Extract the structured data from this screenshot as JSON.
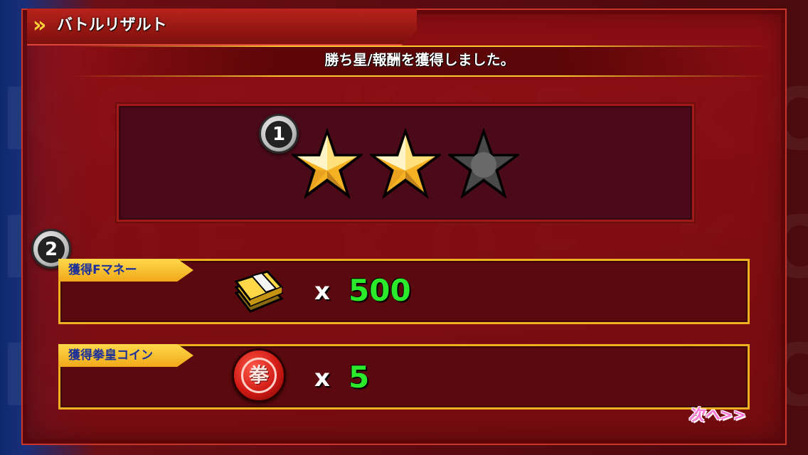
{
  "header": {
    "title": "バトルリザルト"
  },
  "subtitle": "勝ち星/報酬を獲得しました。",
  "badges": {
    "stars_badge": "1",
    "rewards_badge": "2"
  },
  "stars": {
    "earned": 2,
    "total": 3
  },
  "rewards": [
    {
      "label": "獲得Fマネー",
      "multiplier": "x",
      "value": "500",
      "icon": "money-bundle-icon"
    },
    {
      "label": "獲得拳皇コイン",
      "multiplier": "x",
      "value": "5",
      "icon": "fist-coin-icon"
    }
  ],
  "coin_glyph": "拳",
  "next_button": "次へ>>",
  "watermark": "KOF KOF KOF",
  "colors": {
    "accent_gold": "#f0b020",
    "value_green": "#2bea2b",
    "next_pink": "#ff7ad8"
  }
}
